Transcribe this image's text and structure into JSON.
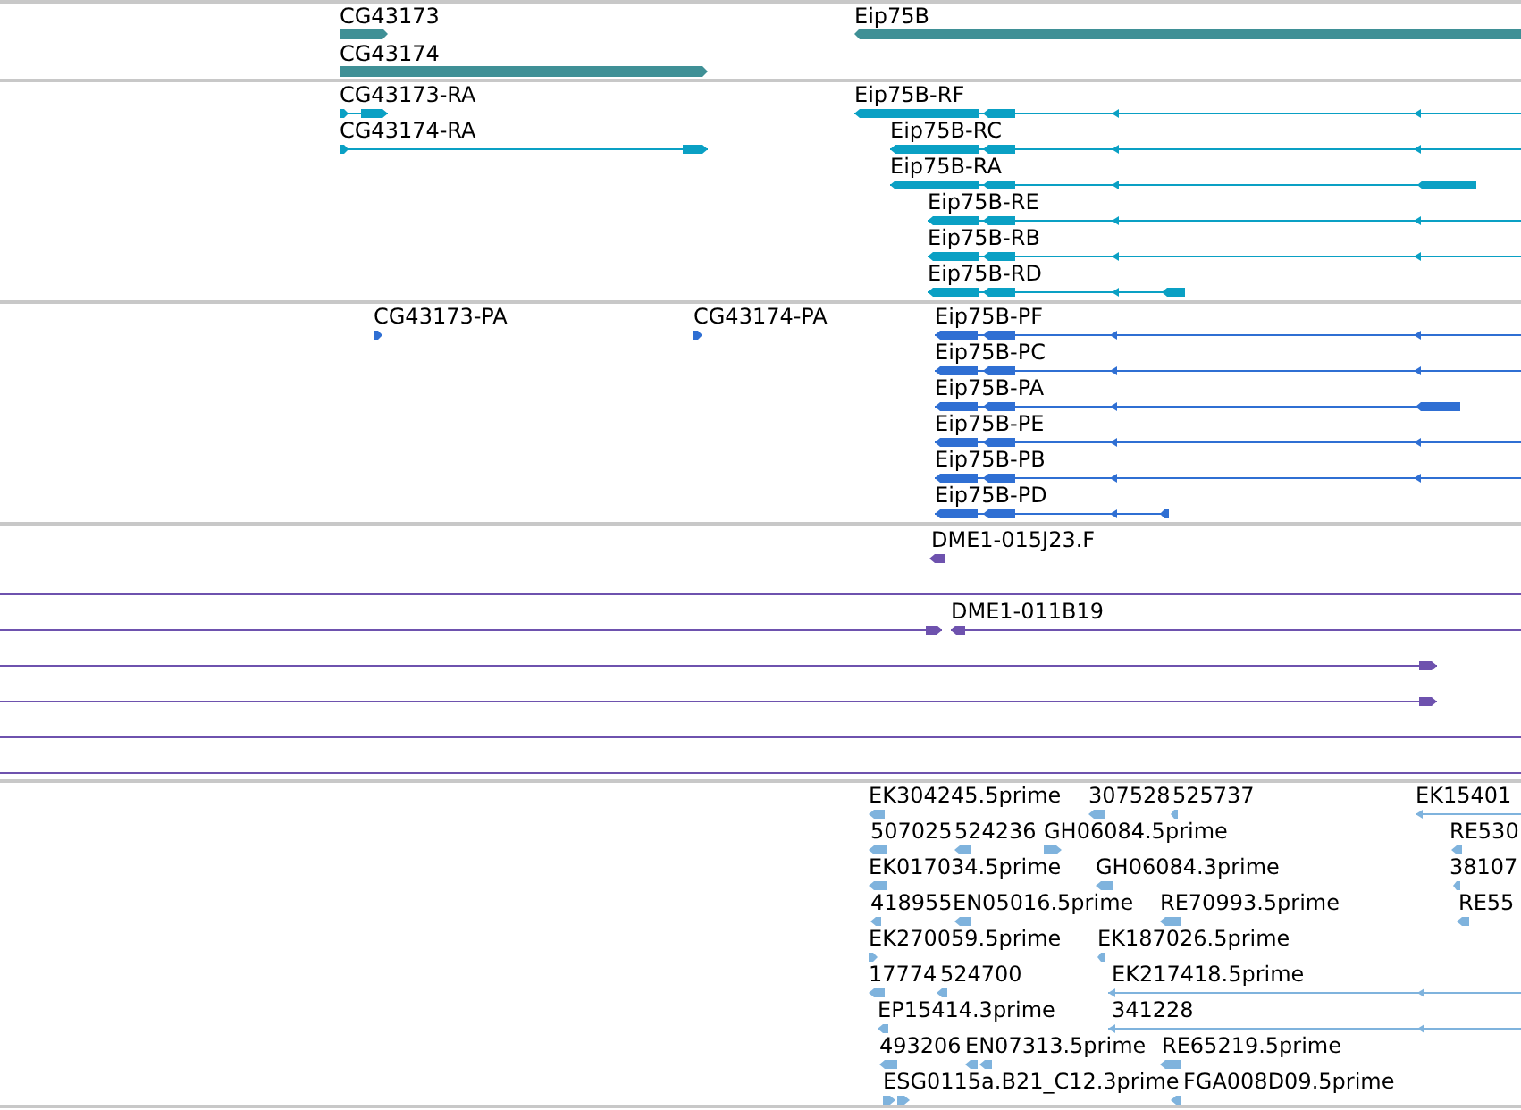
{
  "tracks": [
    {
      "kind": "genes",
      "features": [
        {
          "label": "CG43173",
          "kind": "bar",
          "reverse": false
        },
        {
          "label": "CG43174",
          "kind": "bar",
          "reverse": false
        },
        {
          "label": "Eip75B",
          "kind": "bar",
          "reverse": true
        }
      ]
    },
    {
      "kind": "transcripts",
      "features": [
        {
          "label": "CG43173-RA",
          "kind": "model",
          "reverse": false
        },
        {
          "label": "CG43174-RA",
          "kind": "model",
          "reverse": false
        },
        {
          "label": "Eip75B-RF",
          "kind": "model",
          "reverse": true
        },
        {
          "label": "Eip75B-RC",
          "kind": "model",
          "reverse": true
        },
        {
          "label": "Eip75B-RA",
          "kind": "model",
          "reverse": true
        },
        {
          "label": "Eip75B-RE",
          "kind": "model",
          "reverse": true
        },
        {
          "label": "Eip75B-RB",
          "kind": "model",
          "reverse": true
        },
        {
          "label": "Eip75B-RD",
          "kind": "model",
          "reverse": true
        }
      ]
    },
    {
      "kind": "proteins",
      "features": [
        {
          "label": "CG43173-PA",
          "kind": "arrow",
          "reverse": false
        },
        {
          "label": "CG43174-PA",
          "kind": "arrow",
          "reverse": false
        },
        {
          "label": "Eip75B-PF",
          "kind": "model",
          "reverse": true
        },
        {
          "label": "Eip75B-PC",
          "kind": "model",
          "reverse": true
        },
        {
          "label": "Eip75B-PA",
          "kind": "model",
          "reverse": true
        },
        {
          "label": "Eip75B-PE",
          "kind": "model",
          "reverse": true
        },
        {
          "label": "Eip75B-PB",
          "kind": "model",
          "reverse": true
        },
        {
          "label": "Eip75B-PD",
          "kind": "model",
          "reverse": true
        }
      ]
    },
    {
      "kind": "clones",
      "features": [
        {
          "label": "DME1-015J23.F",
          "kind": "arrow",
          "reverse": true
        },
        {
          "kind": "line"
        },
        {
          "kind": "line",
          "reverse": false
        },
        {
          "label": "DME1-011B19",
          "kind": "line",
          "reverse": true
        },
        {
          "kind": "line",
          "reverse": false
        },
        {
          "kind": "line",
          "reverse": false
        },
        {
          "kind": "line"
        },
        {
          "kind": "line"
        }
      ]
    },
    {
      "kind": "ests",
      "features": [
        {
          "label": "EK304245.5prime",
          "kind": "arrow",
          "reverse": true
        },
        {
          "label": "307528",
          "kind": "arrow",
          "reverse": true
        },
        {
          "label": "525737",
          "kind": "arrow",
          "reverse": true
        },
        {
          "label": "EK15401",
          "kind": "line",
          "reverse": true
        },
        {
          "label": "507025",
          "kind": "arrow",
          "reverse": true
        },
        {
          "label": "524236",
          "kind": "arrow",
          "reverse": true
        },
        {
          "label": "GH06084.5prime",
          "kind": "arrow",
          "reverse": false
        },
        {
          "label": "RE530",
          "kind": "arrow",
          "reverse": true
        },
        {
          "label": "EK017034.5prime",
          "kind": "arrow",
          "reverse": true
        },
        {
          "label": "GH06084.3prime",
          "kind": "arrow",
          "reverse": true
        },
        {
          "label": "38107",
          "kind": "arrow",
          "reverse": true
        },
        {
          "label": "418955",
          "kind": "arrow",
          "reverse": true
        },
        {
          "label": "EN05016.5prime",
          "kind": "arrow",
          "reverse": true
        },
        {
          "label": "RE70993.5prime",
          "kind": "arrow",
          "reverse": true
        },
        {
          "label": "RE55",
          "kind": "arrow",
          "reverse": true
        },
        {
          "label": "EK270059.5prime",
          "kind": "arrow",
          "reverse": false
        },
        {
          "label": "EK187026.5prime",
          "kind": "arrow",
          "reverse": true
        },
        {
          "label": "17774",
          "kind": "arrow",
          "reverse": true
        },
        {
          "label": "524700",
          "kind": "arrow",
          "reverse": true
        },
        {
          "label": "EK217418.5prime",
          "kind": "line",
          "reverse": true
        },
        {
          "label": "EP15414.3prime",
          "kind": "arrow",
          "reverse": true
        },
        {
          "label": "341228",
          "kind": "line",
          "reverse": true
        },
        {
          "label": "493206",
          "kind": "arrow",
          "reverse": true
        },
        {
          "label": "EN07313.5prime",
          "kind": "arrow",
          "reverse": true
        },
        {
          "label": "RE65219.5prime",
          "kind": "arrow",
          "reverse": true
        },
        {
          "label": "ESG0115a.B21_C12.3prime",
          "kind": "arrow",
          "reverse": false
        },
        {
          "label": "FGA008D09.5prime",
          "kind": "arrow",
          "reverse": true
        }
      ]
    }
  ]
}
